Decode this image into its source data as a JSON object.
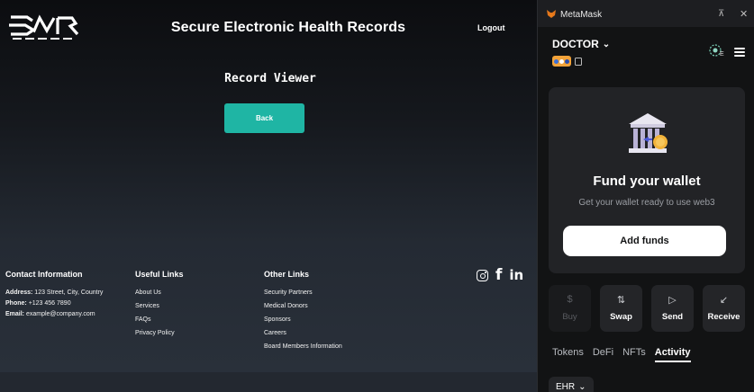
{
  "app": {
    "title": "Secure Electronic Health Records",
    "logout_label": "Logout",
    "page_heading": "Record Viewer",
    "back_label": "Back"
  },
  "footer": {
    "contact": {
      "heading": "Contact Information",
      "address_label": "Address:",
      "address_value": "123 Street, City, Country",
      "phone_label": "Phone:",
      "phone_value": "+123 456 7890",
      "email_label": "Email:",
      "email_value": "example@company.com"
    },
    "useful_links": {
      "heading": "Useful Links",
      "items": [
        "About Us",
        "Services",
        "FAQs",
        "Privacy Policy"
      ]
    },
    "other_links": {
      "heading": "Other Links",
      "items": [
        "Security Partners",
        "Medical Donors",
        "Sponsors",
        "Careers",
        "Board Members Information"
      ]
    },
    "socials": [
      "instagram-icon",
      "facebook-icon",
      "linkedin-icon"
    ]
  },
  "metamask": {
    "window_title": "MetaMask",
    "account_name": "DOCTOR",
    "network_letter": "E",
    "fund_card": {
      "title": "Fund your wallet",
      "subtitle": "Get your wallet ready to use web3",
      "button_label": "Add funds"
    },
    "actions": [
      {
        "label": "Buy",
        "icon": "$",
        "enabled": false
      },
      {
        "label": "Swap",
        "icon": "⇅",
        "enabled": true
      },
      {
        "label": "Send",
        "icon": "▷",
        "enabled": true
      },
      {
        "label": "Receive",
        "icon": "↙",
        "enabled": true
      }
    ],
    "tabs": [
      "Tokens",
      "DeFi",
      "NFTs",
      "Activity"
    ],
    "active_tab": "Activity",
    "filter_label": "EHR"
  },
  "colors": {
    "accent_teal": "#1fb5a4",
    "metamask_bg": "#121314",
    "card_bg": "#222326"
  }
}
